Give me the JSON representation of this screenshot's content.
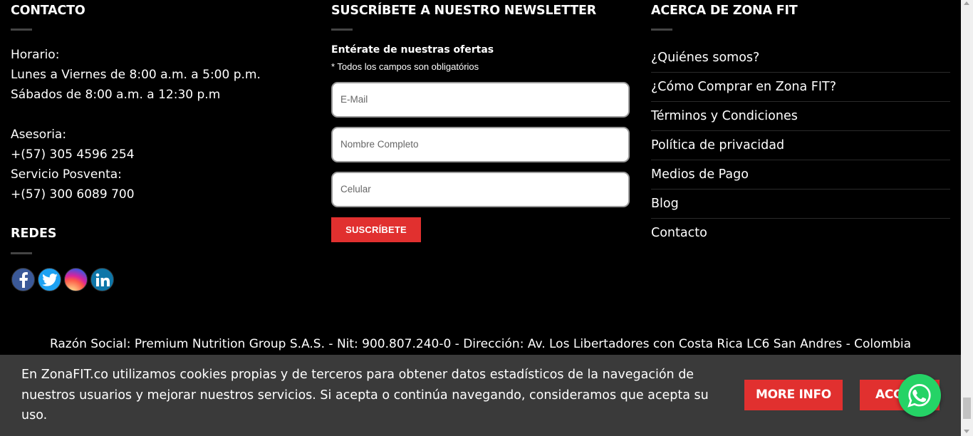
{
  "contact": {
    "title": "CONTACTO",
    "horario_label": "Horario:",
    "weekday_hours": "Lunes a Viernes de 8:00 a.m. a 5:00 p.m.",
    "saturday_hours": "Sábados de 8:00 a.m. a 12:30 p.m",
    "asesoria_label": "Asesoria:",
    "asesoria_phone": "+(57) 305 4596 254",
    "posventa_label": "Servicio Posventa:",
    "posventa_phone": "+(57) 300 6089 700"
  },
  "redes": {
    "title": "REDES",
    "icons": [
      "facebook-icon",
      "twitter-icon",
      "instagram-icon",
      "linkedin-icon"
    ]
  },
  "newsletter": {
    "title": "SUSCRÍBETE A NUESTRO NEWSLETTER",
    "subtitle": "Entérate de nuestras ofertas",
    "required_note": "* Todos los campos son obligatórios",
    "email_placeholder": "E-Mail",
    "name_placeholder": "Nombre Completo",
    "phone_placeholder": "Celular",
    "submit_label": "SUSCRÍBETE"
  },
  "about": {
    "title": "ACERCA DE ZONA FIT",
    "links": [
      "¿Quiénes somos?",
      "¿Cómo Comprar en Zona FIT?",
      "Términos y Condiciones",
      "Política de privacidad",
      "Medios de Pago",
      "Blog",
      "Contacto"
    ]
  },
  "company": {
    "legal_line": "Razón Social: Premium Nutrition Group S.A.S. - Nit: 900.807.240-0 - Dirección: Av. Los Libertadores con Costa Rica LC6 San Andres - Colombia"
  },
  "cookie_banner": {
    "text": "En ZonaFIT.co utilizamos cookies propias y de terceros para obtener datos estadísticos de la navegación de nuestros usuarios y mejorar nuestros servicios. Si acepta o continúa navegando, consideramos que acepta su uso.",
    "more_info_label": "MORE INFO",
    "accept_label": "ACCEPT"
  },
  "colors": {
    "background": "#000000",
    "accent_red": "#e1302f",
    "cookie_bg": "#3a3a3a",
    "whatsapp_green": "#25d366"
  }
}
